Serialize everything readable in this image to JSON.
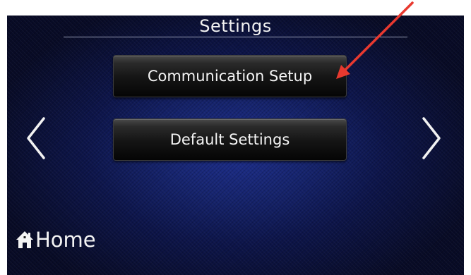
{
  "screen": {
    "title": "Settings",
    "buttons": {
      "communication_setup": "Communication Setup",
      "default_settings": "Default Settings"
    },
    "nav": {
      "prev_icon": "chevron-left-icon",
      "next_icon": "chevron-right-icon"
    },
    "home": {
      "icon": "home-icon",
      "label": "Home"
    }
  },
  "annotation": {
    "color": "#e8392f"
  }
}
